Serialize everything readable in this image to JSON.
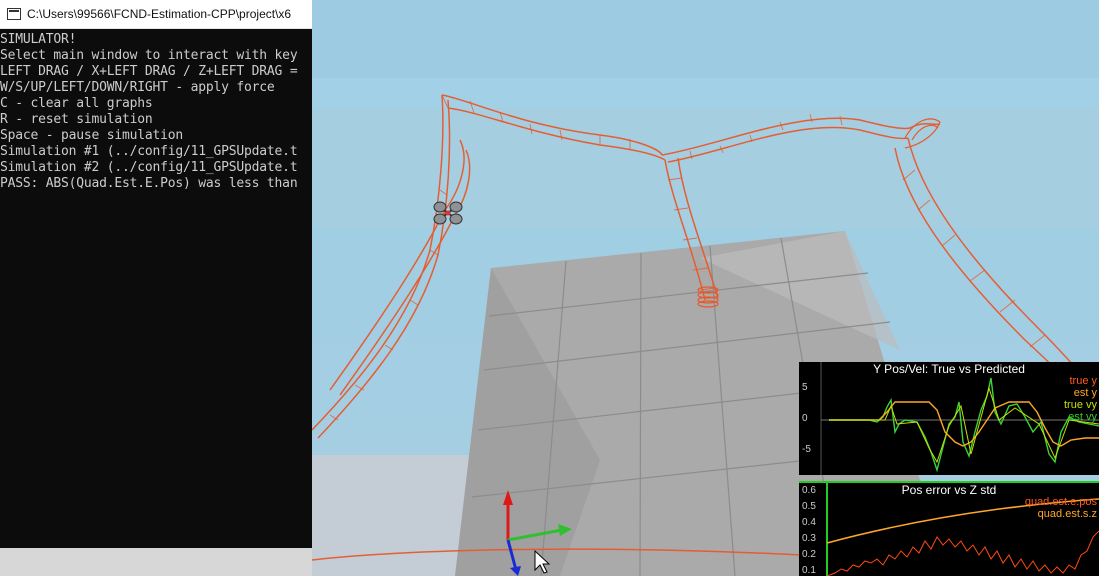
{
  "console": {
    "title": "C:\\Users\\99566\\FCND-Estimation-CPP\\project\\x6",
    "lines": [
      "SIMULATOR!",
      "Select main window to interact with key",
      "LEFT DRAG / X+LEFT DRAG / Z+LEFT DRAG =",
      "W/S/UP/LEFT/DOWN/RIGHT - apply force",
      "C - clear all graphs",
      "R - reset simulation",
      "Space - pause simulation",
      "Simulation #1 (../config/11_GPSUpdate.t",
      "Simulation #2 (../config/11_GPSUpdate.t",
      "PASS: ABS(Quad.Est.E.Pos) was less than"
    ]
  },
  "graph1": {
    "title": "Y Pos/Vel: True vs Predicted",
    "legend": [
      {
        "label": "true y",
        "color": "#ff5a1f"
      },
      {
        "label": "est y",
        "color": "#ffa726"
      },
      {
        "label": "true vy",
        "color": "#c6e000"
      },
      {
        "label": "est vy",
        "color": "#33cc33"
      }
    ],
    "yticks": [
      "5",
      "0",
      "-5"
    ]
  },
  "graph2": {
    "title": "Pos error vs Z std",
    "legend": [
      {
        "label": "quad.est.e.pos",
        "color": "#ff5a1f"
      },
      {
        "label": "quad.est.s.z",
        "color": "#ffa726"
      }
    ],
    "yticks": [
      "0.6",
      "0.5",
      "0.4",
      "0.3",
      "0.2",
      "0.1"
    ]
  }
}
